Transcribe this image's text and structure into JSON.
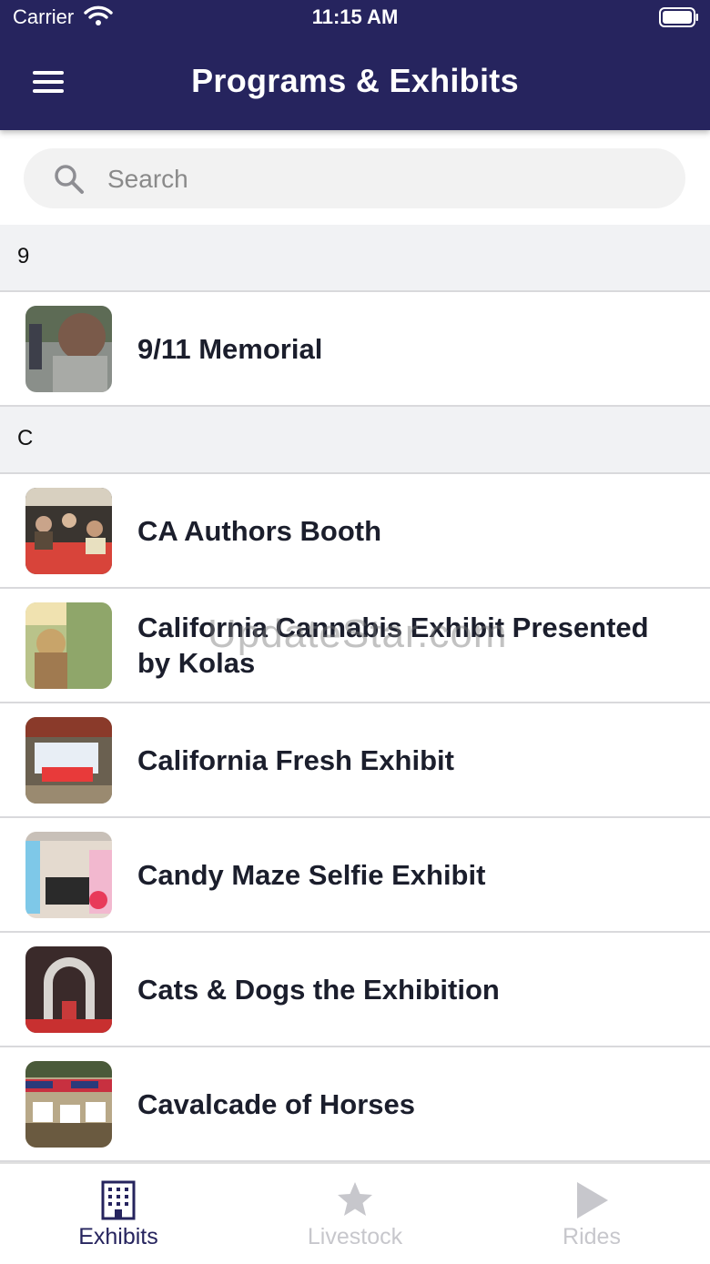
{
  "status_bar": {
    "carrier": "Carrier",
    "time": "11:15 AM"
  },
  "header": {
    "title": "Programs & Exhibits"
  },
  "search": {
    "placeholder": "Search",
    "value": ""
  },
  "sections": [
    {
      "letter": "9",
      "items": [
        {
          "label": "9/11 Memorial"
        }
      ]
    },
    {
      "letter": "C",
      "items": [
        {
          "label": "CA Authors Booth"
        },
        {
          "label": "California Cannabis Exhibit Presented by Kolas"
        },
        {
          "label": "California Fresh Exhibit"
        },
        {
          "label": "Candy Maze Selfie Exhibit"
        },
        {
          "label": "Cats & Dogs the Exhibition"
        },
        {
          "label": "Cavalcade of Horses"
        }
      ]
    }
  ],
  "watermark": "UpdateStar.com",
  "tabbar": {
    "tabs": [
      {
        "label": "Exhibits",
        "icon": "building-icon",
        "active": true
      },
      {
        "label": "Livestock",
        "icon": "star-icon",
        "active": false
      },
      {
        "label": "Rides",
        "icon": "play-icon",
        "active": false
      }
    ]
  },
  "colors": {
    "header_bg": "#26245e",
    "active_tab": "#26245e",
    "inactive_tab": "#c7c7cc",
    "section_bg": "#f1f2f4"
  }
}
